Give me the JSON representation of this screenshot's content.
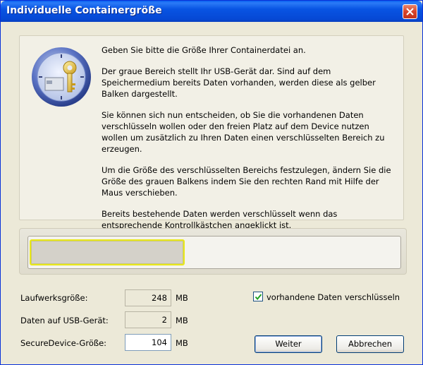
{
  "window": {
    "title": "Individuelle Containergröße"
  },
  "info": {
    "paragraphs": [
      "Geben Sie bitte die Größe Ihrer Containerdatei an.",
      "Der graue Bereich stellt Ihr USB-Gerät dar. Sind auf dem Speichermedium bereits Daten vorhanden, werden diese als gelber Balken dargestellt.",
      "Sie können sich nun entscheiden, ob Sie die vorhandenen Daten verschlüsseln wollen oder den freien Platz auf dem Device nutzen wollen um zusätzlich zu Ihren Daten einen verschlüsselten Bereich zu erzeugen.",
      "Um die Größe des verschlüsselten Bereichs festzulegen, ändern Sie die Größe des grauen Balkens indem Sie den rechten Rand mit Hilfe der Maus verschieben.",
      "Bereits bestehende Daten werden verschlüsselt wenn das entsprechende Kontrollkästchen angeklickt ist."
    ]
  },
  "size_bar": {
    "container_fraction": 0.42,
    "existing_data_fraction": 0.008
  },
  "fields": {
    "drive_size": {
      "label": "Laufwerksgröße:",
      "value": "248",
      "unit": "MB"
    },
    "usb_data": {
      "label": "Daten auf USB-Gerät:",
      "value": "2",
      "unit": "MB"
    },
    "secure_size": {
      "label": "SecureDevice-Größe:",
      "value": "104",
      "unit": "MB"
    }
  },
  "encrypt_existing": {
    "label": "vorhandene Daten verschlüsseln",
    "checked": true
  },
  "buttons": {
    "next": "Weiter",
    "cancel": "Abbrechen"
  },
  "colors": {
    "titlebar": "#0854e3",
    "bar_highlight": "#e9e81a",
    "bar_fill": "#d4d1c9"
  }
}
